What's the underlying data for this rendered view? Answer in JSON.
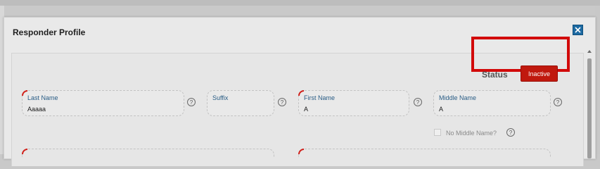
{
  "dialog": {
    "title": "Responder Profile"
  },
  "status": {
    "label": "Status",
    "badge": "Inactive",
    "badge_color": "#c0190e",
    "highlight_color": "#d20a0a"
  },
  "fields": {
    "last_name": {
      "label": "Last Name",
      "value": "Aaaaa",
      "required": true
    },
    "suffix": {
      "label": "Suffix",
      "value": "",
      "required": false
    },
    "first_name": {
      "label": "First Name",
      "value": "A",
      "required": true
    },
    "middle_name": {
      "label": "Middle Name",
      "value": "A",
      "required": false
    }
  },
  "no_middle_name": {
    "label": "No Middle Name?",
    "checked": false
  },
  "icons": {
    "close": "close-icon",
    "help": "help-icon",
    "scroll_up": "chevron-up-icon"
  },
  "help_glyph": "?"
}
